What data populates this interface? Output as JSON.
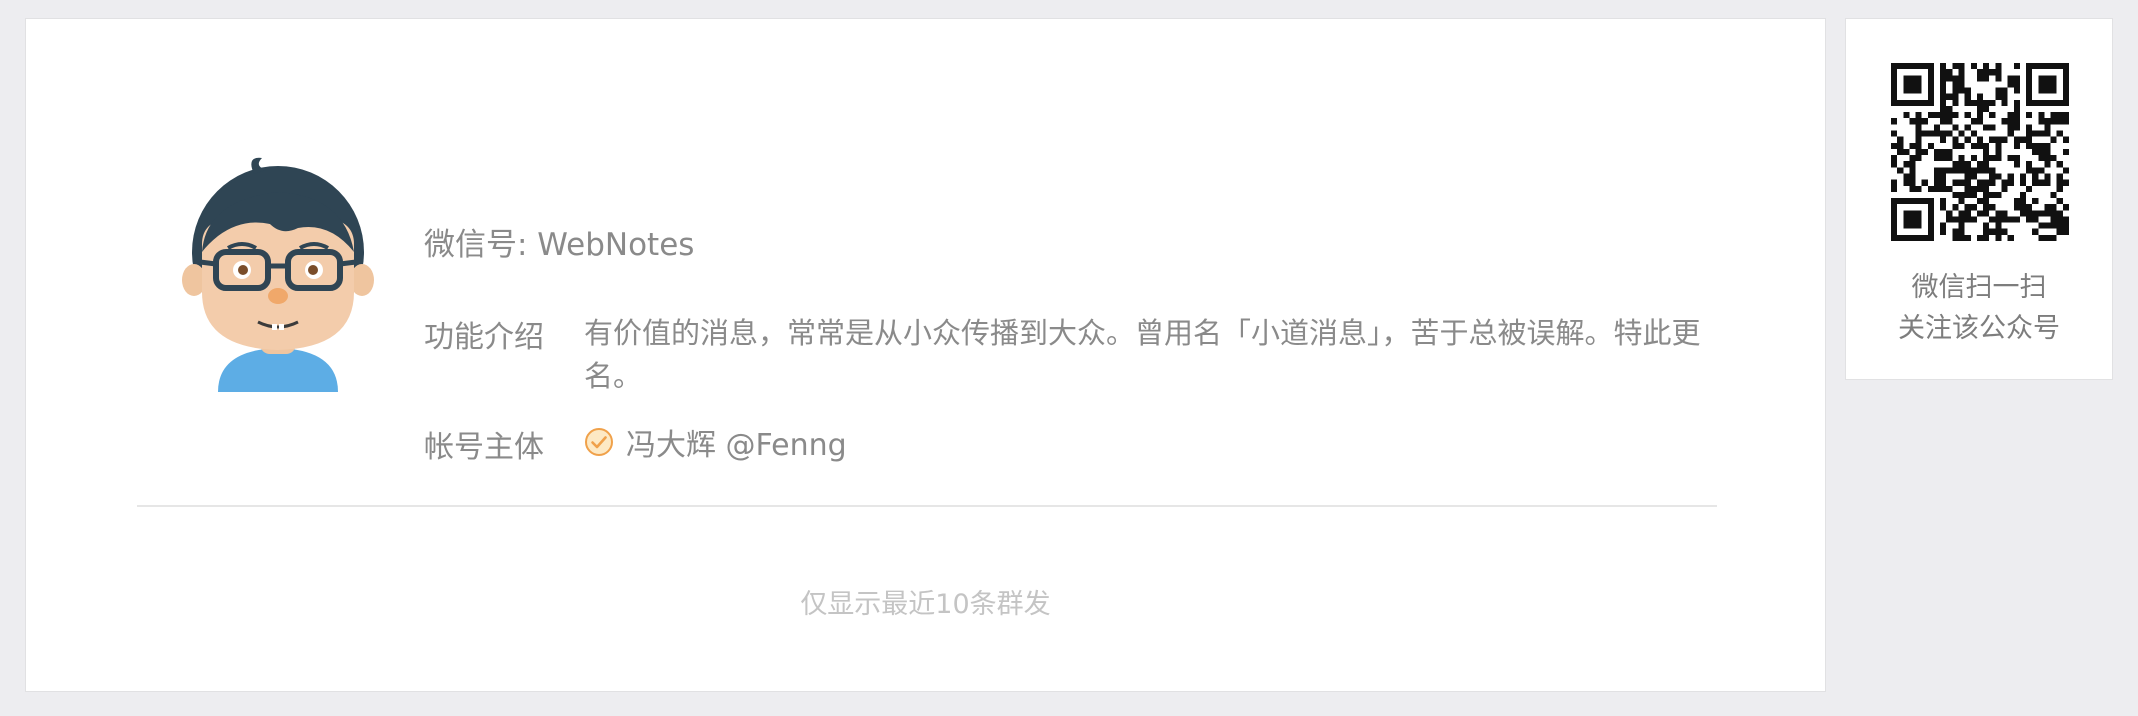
{
  "account": {
    "wechat_id": "微信号: WebNotes",
    "intro_label": "功能介绍",
    "intro_text": "有价值的消息，常常是从小众传播到大众。曾用名「小道消息」，苦于总被误解。特此更名。",
    "owner_label": "帐号主体",
    "owner_name": "冯大辉 @Fenng",
    "owner_verified_icon": "verified-check-icon"
  },
  "feed": {
    "notice": "仅显示最近10条群发"
  },
  "qr": {
    "caption_line1": "微信扫一扫",
    "caption_line2": "关注该公众号"
  },
  "colors": {
    "page_background": "#ededf0",
    "card_background": "#ffffff",
    "label_text": "#8a8a8a",
    "muted_text": "#c4c4c4",
    "verified_orange": "#f0a14a",
    "avatar_hair": "#2f4554",
    "avatar_shirt": "#5dade5"
  }
}
